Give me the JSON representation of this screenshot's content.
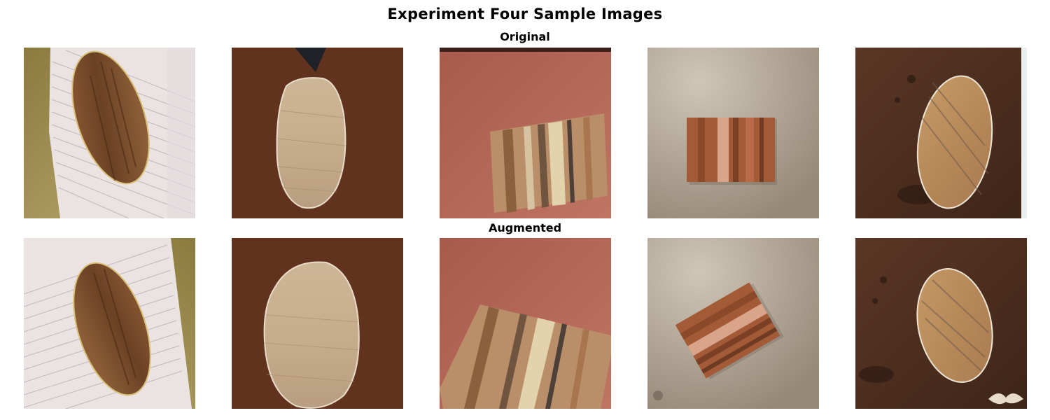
{
  "figure": {
    "title": "Experiment Four Sample Images",
    "rows": [
      {
        "label": "Original",
        "samples": [
          {
            "subject": "oval-dark-veneer-on-notebook"
          },
          {
            "subject": "oval-light-veneer-on-desk"
          },
          {
            "subject": "rect-striped-veneer-on-red"
          },
          {
            "subject": "rect-striped-veneer-on-concrete"
          },
          {
            "subject": "oval-veneer-on-wood"
          }
        ]
      },
      {
        "label": "Augmented",
        "samples": [
          {
            "subject": "oval-dark-veneer-on-notebook"
          },
          {
            "subject": "oval-light-veneer-on-desk"
          },
          {
            "subject": "rect-striped-veneer-on-red"
          },
          {
            "subject": "rect-striped-veneer-on-concrete"
          },
          {
            "subject": "oval-veneer-on-wood"
          }
        ]
      }
    ]
  },
  "colors": {
    "notebook_paper": "#ece4e2",
    "dark_veneer": "#7a4f2c",
    "desk_brown": "#5a2e1c",
    "light_veneer": "#c9b394",
    "red_leather": "#b8685a",
    "concrete": "#a39582",
    "striped_veneer": "#b07a55",
    "wood_surface": "#4e2f1f"
  }
}
